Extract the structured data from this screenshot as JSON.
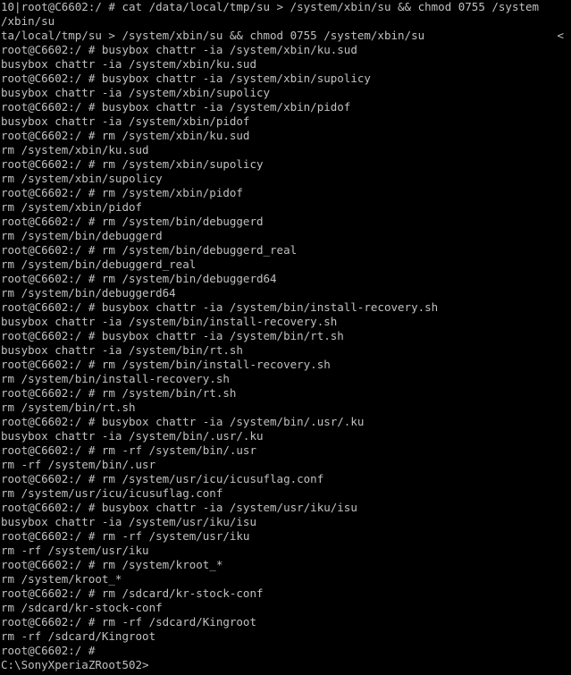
{
  "colors": {
    "background": "#000000",
    "text": "#c0c0c0"
  },
  "console": {
    "lines": [
      "10|root@C6602:/ # cat /data/local/tmp/su > /system/xbin/su && chmod 0755 /system",
      "/xbin/su",
      "ta/local/tmp/su > /system/xbin/su && chmod 0755 /system/xbin/su",
      "root@C6602:/ # busybox chattr -ia /system/xbin/ku.sud",
      "busybox chattr -ia /system/xbin/ku.sud",
      "root@C6602:/ # busybox chattr -ia /system/xbin/supolicy",
      "busybox chattr -ia /system/xbin/supolicy",
      "root@C6602:/ # busybox chattr -ia /system/xbin/pidof",
      "busybox chattr -ia /system/xbin/pidof",
      "root@C6602:/ # rm /system/xbin/ku.sud",
      "rm /system/xbin/ku.sud",
      "root@C6602:/ # rm /system/xbin/supolicy",
      "rm /system/xbin/supolicy",
      "root@C6602:/ # rm /system/xbin/pidof",
      "rm /system/xbin/pidof",
      "root@C6602:/ # rm /system/bin/debuggerd",
      "rm /system/bin/debuggerd",
      "root@C6602:/ # rm /system/bin/debuggerd_real",
      "rm /system/bin/debuggerd_real",
      "root@C6602:/ # rm /system/bin/debuggerd64",
      "rm /system/bin/debuggerd64",
      "root@C6602:/ # busybox chattr -ia /system/bin/install-recovery.sh",
      "busybox chattr -ia /system/bin/install-recovery.sh",
      "root@C6602:/ # busybox chattr -ia /system/bin/rt.sh",
      "busybox chattr -ia /system/bin/rt.sh",
      "root@C6602:/ # rm /system/bin/install-recovery.sh",
      "rm /system/bin/install-recovery.sh",
      "root@C6602:/ # rm /system/bin/rt.sh",
      "rm /system/bin/rt.sh",
      "root@C6602:/ # busybox chattr -ia /system/bin/.usr/.ku",
      "busybox chattr -ia /system/bin/.usr/.ku",
      "root@C6602:/ # rm -rf /system/bin/.usr",
      "rm -rf /system/bin/.usr",
      "root@C6602:/ # rm /system/usr/icu/icusuflag.conf",
      "rm /system/usr/icu/icusuflag.conf",
      "root@C6602:/ # busybox chattr -ia /system/usr/iku/isu",
      "busybox chattr -ia /system/usr/iku/isu",
      "root@C6602:/ # rm -rf /system/usr/iku",
      "rm -rf /system/usr/iku",
      "root@C6602:/ # rm /system/kroot_*",
      "rm /system/kroot_*",
      "root@C6602:/ # rm /sdcard/kr-stock-conf",
      "rm /sdcard/kr-stock-conf",
      "root@C6602:/ # rm -rf /sdcard/Kingroot",
      "rm -rf /sdcard/Kingroot",
      "root@C6602:/ #"
    ],
    "wrap_marker": "<",
    "host_prompt": "C:\\SonyXperiaZRoot502>"
  }
}
